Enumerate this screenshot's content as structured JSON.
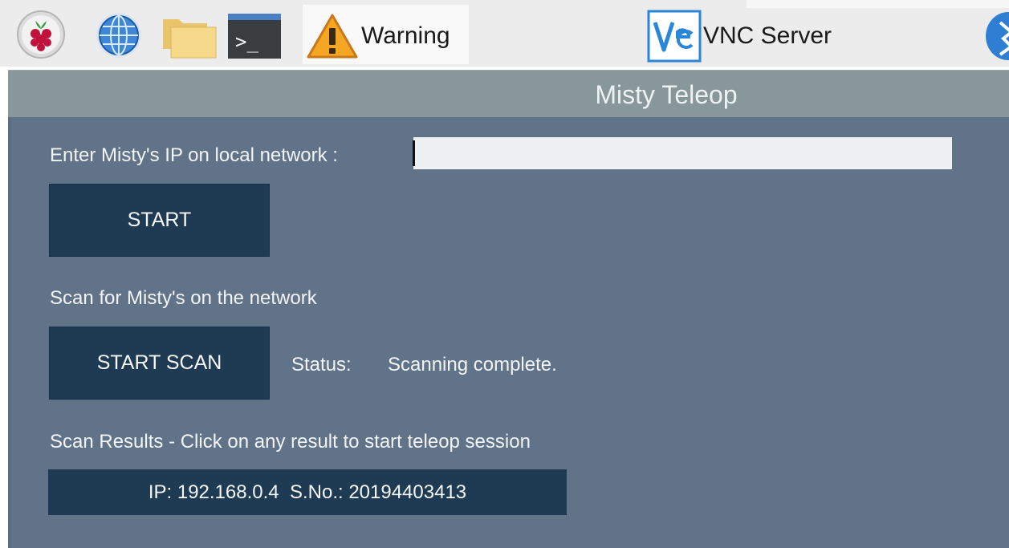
{
  "taskbar": {
    "icons": [
      "raspberry-menu-icon",
      "web-browser-icon",
      "file-manager-icon",
      "terminal-icon"
    ],
    "warning_label": "Warning",
    "vnc_label": "VNC Server"
  },
  "window": {
    "title": "Misty Teleop"
  },
  "form": {
    "ip_label": "Enter Misty's IP on local network :",
    "ip_value": "",
    "start_label": "START",
    "scan_label": "Scan for Misty's on the network",
    "start_scan_label": "START SCAN",
    "status_label": "Status:",
    "status_value": "Scanning complete.",
    "results_label": "Scan Results - Click on any result to start teleop session",
    "results": [
      {
        "text": "IP: 192.168.0.4  S.No.: 20194403413"
      }
    ]
  },
  "colors": {
    "body_bg": "#617388",
    "titlebar_bg": "#88979a",
    "button_bg": "#1f3a53"
  }
}
